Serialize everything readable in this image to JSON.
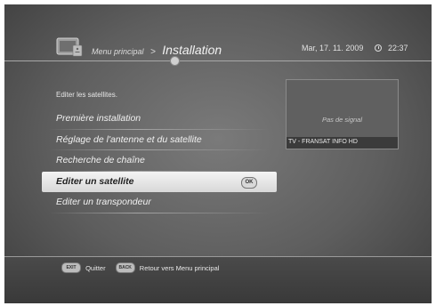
{
  "header": {
    "breadcrumb_parent": "Menu principal",
    "breadcrumb_separator": ">",
    "title": "Installation",
    "date": "Mar, 17. 11. 2009",
    "time": "22:37"
  },
  "main": {
    "subtitle": "Editer les satellites.",
    "menu_items": [
      {
        "label": "Première installation"
      },
      {
        "label": "Réglage de l'antenne et du satellite"
      },
      {
        "label": "Recherche de chaîne"
      },
      {
        "label": "Editer un satellite",
        "selected": true,
        "badge": "OK"
      },
      {
        "label": "Editer un transpondeur"
      }
    ]
  },
  "preview": {
    "message": "Pas de signal",
    "channel": "TV - FRANSAT INFO HD"
  },
  "footer": {
    "exit_key": "EXIT",
    "exit_label": "Quitter",
    "back_key": "BACK",
    "back_label": "Retour vers Menu principal"
  },
  "icons": [
    "tv-icon",
    "clock-icon"
  ],
  "colors": {
    "selection": "#e6e6e6",
    "background": "#5e5e5e"
  }
}
